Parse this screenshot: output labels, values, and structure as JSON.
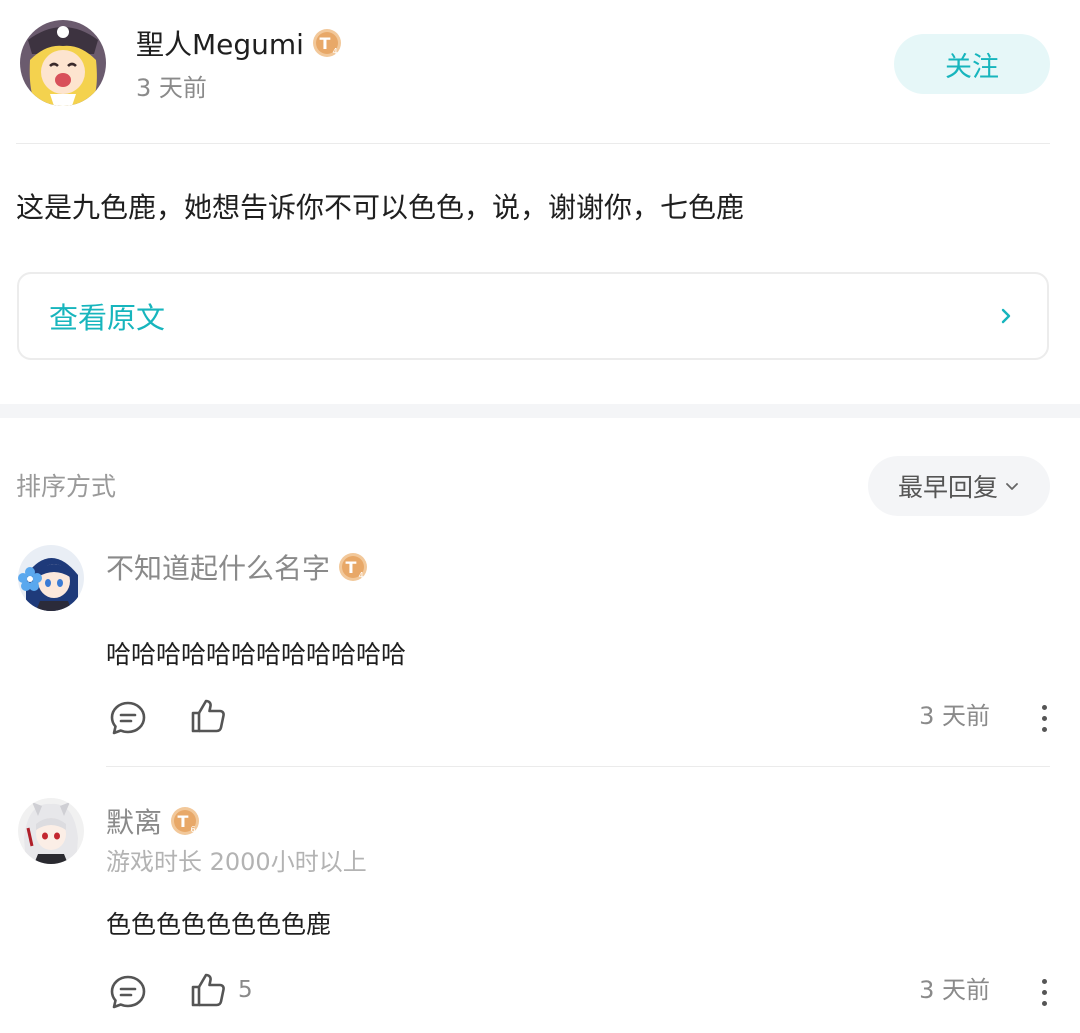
{
  "post": {
    "author": {
      "name": "聖人Megumi",
      "level_badge": "T4",
      "avatar": "anime-girl-avatar"
    },
    "time": "3 天前",
    "follow_label": "关注",
    "content": "这是九色鹿，她想告诉你不可以色色，说，谢谢你，七色鹿",
    "view_original_label": "查看原文"
  },
  "sort": {
    "label": "排序方式",
    "selected": "最早回复"
  },
  "comments": [
    {
      "author": "不知道起什么名字",
      "level_badge": "T4",
      "meta": "",
      "text": "哈哈哈哈哈哈哈哈哈哈哈哈",
      "like_count": "",
      "time": "3 天前",
      "avatar": "blue-hair-flower-avatar"
    },
    {
      "author": "默离",
      "level_badge": "T6",
      "meta": "游戏时长 2000小时以上",
      "text": "色色色色色色色色鹿",
      "like_count": "5",
      "time": "3 天前",
      "avatar": "white-hair-red-eye-avatar"
    }
  ],
  "icons": {
    "reply": "comment-bubble-icon",
    "like": "thumbs-up-icon",
    "more": "more-vertical-icon",
    "chevron_right": "chevron-right-icon",
    "chevron_down": "chevron-down-icon"
  },
  "colors": {
    "accent": "#17b5bd",
    "follow_bg": "#e6f7f8",
    "badge": "#e8b27a"
  }
}
